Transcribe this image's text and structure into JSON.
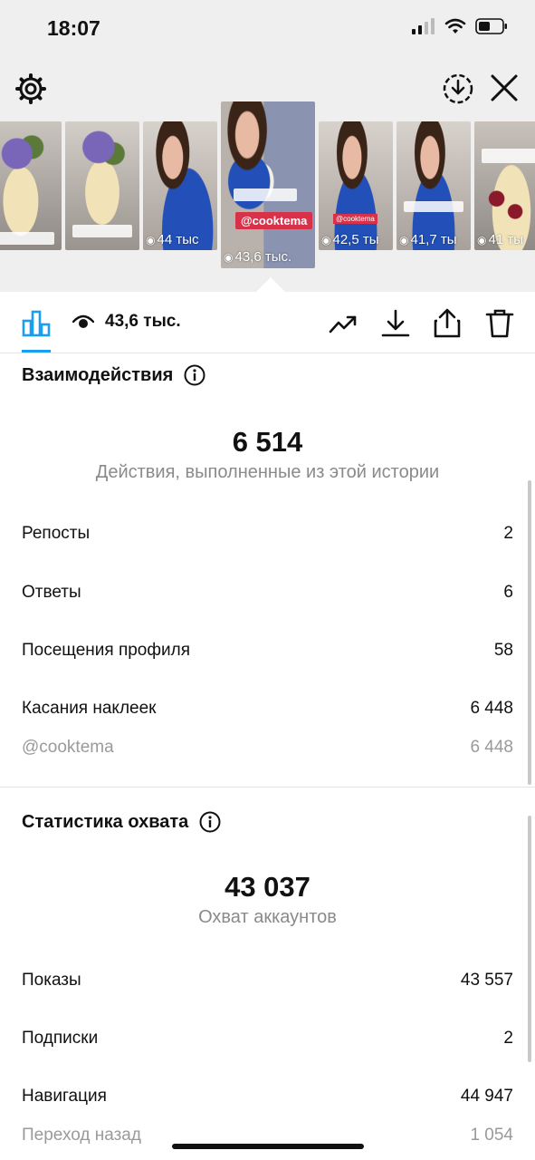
{
  "status_bar": {
    "time": "18:07"
  },
  "thumbnails": [
    {
      "views": "",
      "caption": ""
    },
    {
      "views": "",
      "caption": ""
    },
    {
      "views": "44 тыс",
      "caption": ""
    },
    {
      "views": "43,6 тыс.",
      "tag": "@cooktema"
    },
    {
      "views": "42,5 ты",
      "tag": "@cooktema"
    },
    {
      "views": "41,7 ты",
      "tag": ""
    },
    {
      "views": "41 ты",
      "tag": ""
    }
  ],
  "toolbar": {
    "viewers": "43,6 тыс."
  },
  "interactions": {
    "title": "Взаимодействия",
    "total": "6 514",
    "caption": "Действия, выполненные из этой истории",
    "rows": [
      {
        "label": "Репосты",
        "value": "2"
      },
      {
        "label": "Ответы",
        "value": "6"
      },
      {
        "label": "Посещения профиля",
        "value": "58"
      },
      {
        "label": "Касания наклеек",
        "value": "6 448"
      }
    ],
    "sub_row": {
      "label": "@cooktema",
      "value": "6 448"
    }
  },
  "reach": {
    "title": "Статистика охвата",
    "total": "43 037",
    "caption": "Охват аккаунтов",
    "rows": [
      {
        "label": "Показы",
        "value": "43 557"
      },
      {
        "label": "Подписки",
        "value": "2"
      },
      {
        "label": "Навигация",
        "value": "44 947"
      }
    ],
    "sub_row": {
      "label": "Переход назад",
      "value": "1 054"
    }
  },
  "colors": {
    "accent": "#1b9df0",
    "tag": "#d8324a",
    "muted": "#8a8a8a"
  },
  "icons": [
    "gear-icon",
    "save-story-icon",
    "close-icon",
    "bar-chart-icon",
    "eye-icon",
    "trending-icon",
    "download-icon",
    "share-icon",
    "trash-icon",
    "info-icon"
  ]
}
